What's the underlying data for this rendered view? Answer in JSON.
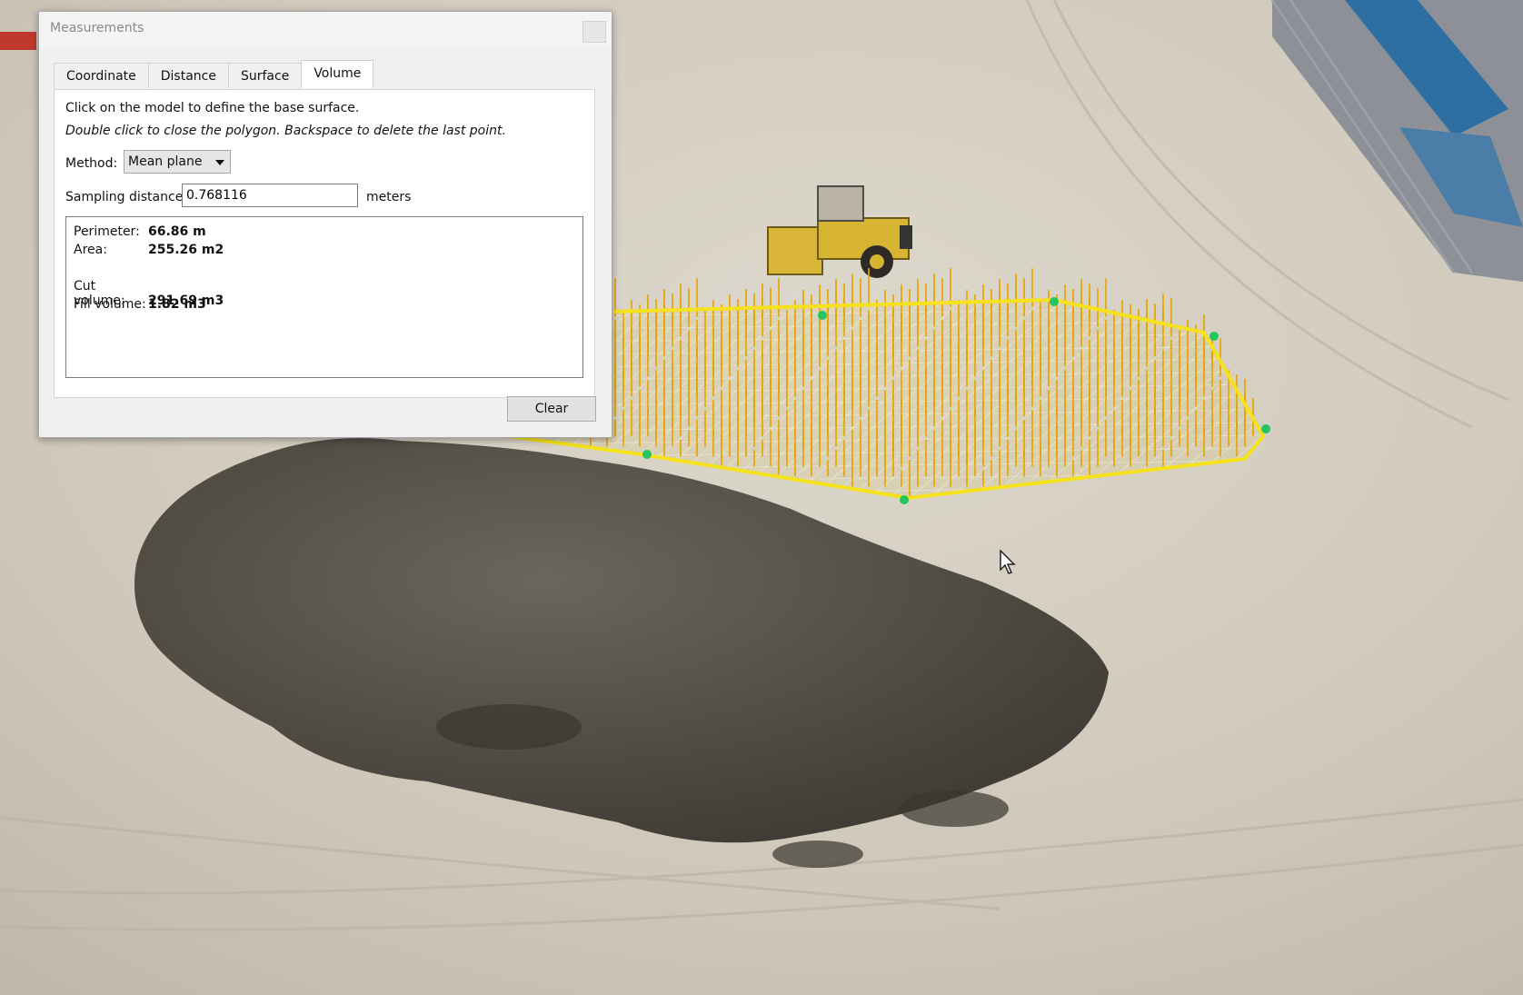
{
  "dialog": {
    "title": "Measurements",
    "tabs": [
      {
        "label": "Coordinate"
      },
      {
        "label": "Distance"
      },
      {
        "label": "Surface"
      },
      {
        "label": "Volume",
        "active": true
      }
    ],
    "instruction_line1": "Click on the model to define the base surface.",
    "instruction_line2": "Double click to close the polygon. Backspace to delete the last point.",
    "method": {
      "label": "Method:",
      "selected": "Mean plane"
    },
    "sampling": {
      "label": "Sampling distance:",
      "value": "0.768116",
      "unit": "meters"
    },
    "results": {
      "perimeter": {
        "label": "Perimeter:",
        "value": "66.86 m"
      },
      "area": {
        "label": "Area:",
        "value": "255.26 m2"
      },
      "cut_volume": {
        "label": "Cut volume:",
        "value": "291.69 m3"
      },
      "fill_volume": {
        "label": "Fill volume:",
        "value": "1.82 m3"
      }
    },
    "clear_label": "Clear"
  },
  "viewport": {
    "description_icons": [
      "roller-compactor",
      "dirt-pile",
      "shipping-containers",
      "fence"
    ],
    "colors": {
      "sand": "#d3cdc1",
      "dark_soil": "#4a463f",
      "polygon_outline": "#f5e21a",
      "grid_lines": "#ffffff",
      "posts": "#e8a400",
      "vertex_points": "#22c55e",
      "sample_points": "#2b3fc9"
    }
  }
}
